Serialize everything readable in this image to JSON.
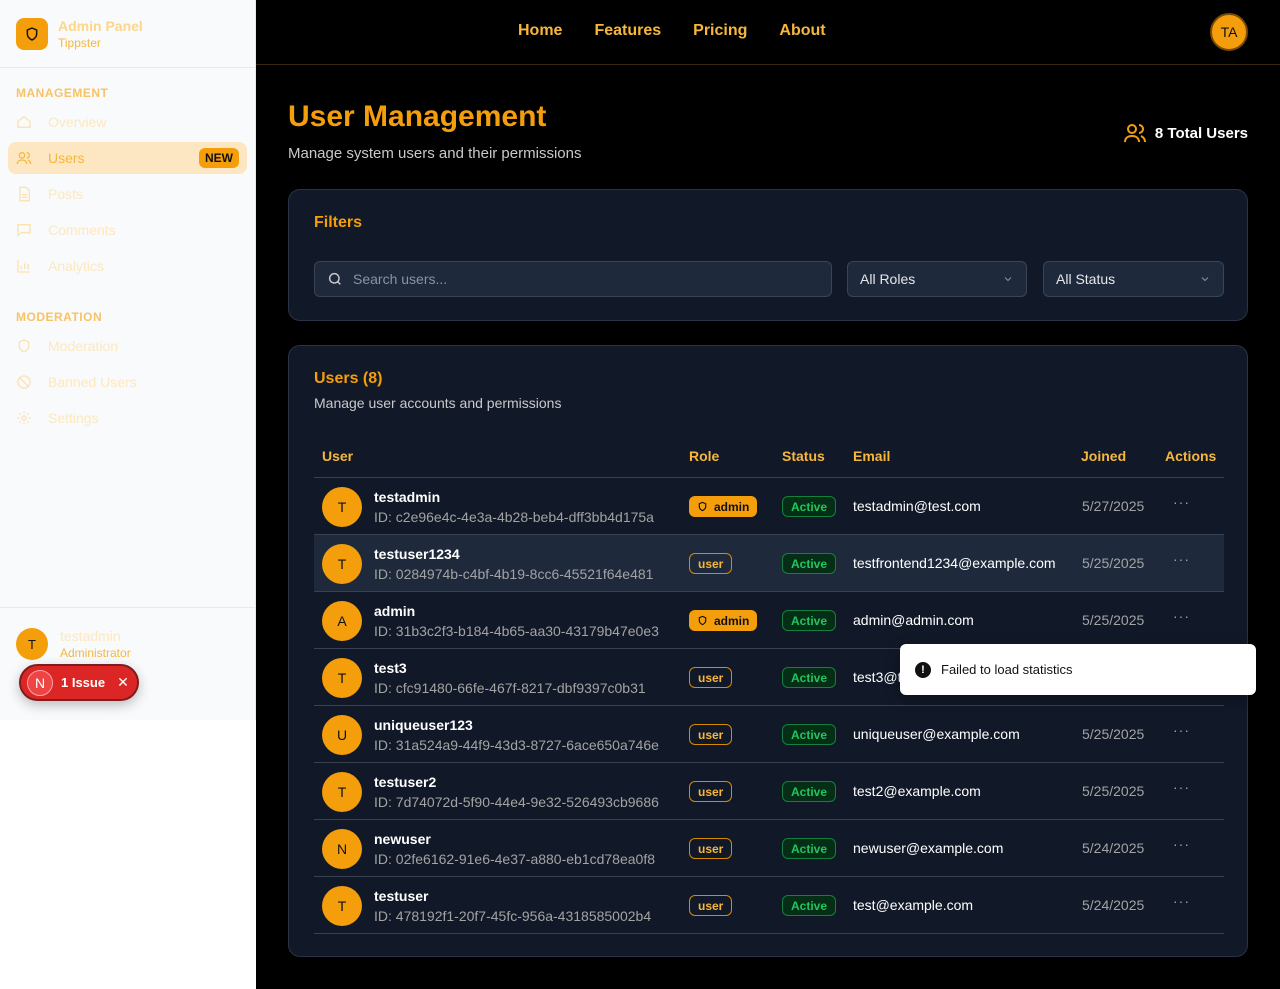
{
  "sidebar": {
    "brand_name": "Admin Panel",
    "brand_sub": "Tippster",
    "sections": [
      {
        "label": "MANAGEMENT"
      },
      {
        "label": "MODERATION"
      }
    ],
    "items": [
      {
        "label": "Overview"
      },
      {
        "label": "Users",
        "badge": "NEW"
      },
      {
        "label": "Posts"
      },
      {
        "label": "Comments"
      },
      {
        "label": "Analytics"
      },
      {
        "label": "Moderation"
      },
      {
        "label": "Banned Users"
      },
      {
        "label": "Settings"
      }
    ],
    "user": {
      "initial": "T",
      "name": "testadmin",
      "role": "Administrator"
    }
  },
  "issue": {
    "letter": "N",
    "label": "1 Issue",
    "close": "✕"
  },
  "topnav": {
    "items": [
      "Home",
      "Features",
      "Pricing",
      "About"
    ],
    "avatar": "TA"
  },
  "page": {
    "title": "User Management",
    "subtitle": "Manage system users and their permissions",
    "total": "8 Total Users"
  },
  "filters": {
    "title": "Filters",
    "search_placeholder": "Search users...",
    "role_select": "All Roles",
    "status_select": "All Status"
  },
  "users": {
    "title": "Users (8)",
    "subtitle": "Manage user accounts and permissions",
    "columns": [
      "User",
      "Role",
      "Status",
      "Email",
      "Joined",
      "Actions"
    ],
    "rows": [
      {
        "initial": "T",
        "name": "testadmin",
        "id": "ID: c2e96e4c-4e3a-4b28-beb4-dff3bb4d175a",
        "role": "admin",
        "status": "Active",
        "email": "testadmin@test.com",
        "joined": "5/27/2025",
        "actions": "···"
      },
      {
        "initial": "T",
        "name": "testuser1234",
        "id": "ID: 0284974b-c4bf-4b19-8cc6-45521f64e481",
        "role": "user",
        "status": "Active",
        "email": "testfrontend1234@example.com",
        "joined": "5/25/2025",
        "actions": "···"
      },
      {
        "initial": "A",
        "name": "admin",
        "id": "ID: 31b3c2f3-b184-4b65-aa30-43179b47e0e3",
        "role": "admin",
        "status": "Active",
        "email": "admin@admin.com",
        "joined": "5/25/2025",
        "actions": "···"
      },
      {
        "initial": "T",
        "name": "test3",
        "id": "ID: cfc91480-66fe-467f-8217-dbf9397c0b31",
        "role": "user",
        "status": "Active",
        "email": "test3@t",
        "joined": "",
        "actions": ""
      },
      {
        "initial": "U",
        "name": "uniqueuser123",
        "id": "ID: 31a524a9-44f9-43d3-8727-6ace650a746e",
        "role": "user",
        "status": "Active",
        "email": "uniqueuser@example.com",
        "joined": "5/25/2025",
        "actions": "···"
      },
      {
        "initial": "T",
        "name": "testuser2",
        "id": "ID: 7d74072d-5f90-44e4-9e32-526493cb9686",
        "role": "user",
        "status": "Active",
        "email": "test2@example.com",
        "joined": "5/25/2025",
        "actions": "···"
      },
      {
        "initial": "N",
        "name": "newuser",
        "id": "ID: 02fe6162-91e6-4e37-a880-eb1cd78ea0f8",
        "role": "user",
        "status": "Active",
        "email": "newuser@example.com",
        "joined": "5/24/2025",
        "actions": "···"
      },
      {
        "initial": "T",
        "name": "testuser",
        "id": "ID: 478192f1-20f7-45fc-956a-4318585002b4",
        "role": "user",
        "status": "Active",
        "email": "test@example.com",
        "joined": "5/24/2025",
        "actions": "···"
      }
    ]
  },
  "toast": {
    "icon": "!",
    "message": "Failed to load statistics"
  }
}
